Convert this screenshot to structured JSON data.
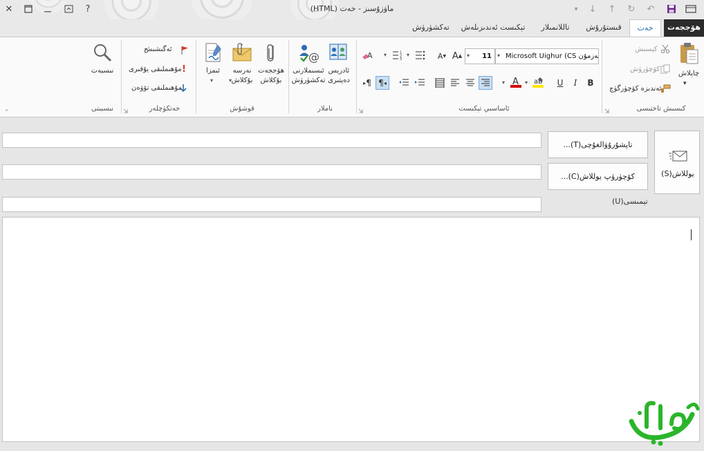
{
  "window": {
    "title": "ماۋزۇسىز - خەت (HTML)"
  },
  "titlebar_icons": {
    "close": "✕",
    "restore": "▭",
    "ribbon_options": "▣",
    "help": "?",
    "customize": "▾",
    "down": "↓",
    "up": "↑",
    "redo": "↻",
    "undo": "↶",
    "save": "save-icon",
    "app": "app-icon"
  },
  "tabs": [
    {
      "label": "ھۆججەت",
      "active": false,
      "file": true
    },
    {
      "label": "خەت",
      "active": true,
      "file": false
    },
    {
      "label": "قىستۇرۇش",
      "active": false,
      "file": false
    },
    {
      "label": "تاللانمىلار",
      "active": false,
      "file": false
    },
    {
      "label": "تېكىست ئەندىزىلەش",
      "active": false,
      "file": false
    },
    {
      "label": "تەكشۈرۈش",
      "active": false,
      "file": false
    }
  ],
  "ribbon": {
    "clipboard": {
      "group_label": "كىسىش تاختىسى",
      "paste": "چاپلاش",
      "cut": "كېسىش",
      "copy": "كۆچۈرۈش",
      "format_painter": "ئەندىزە كۆچۈرگۈچ"
    },
    "basic_text": {
      "group_label": "ئاساسىي تېكىست",
      "font_name": "Microsoft Uighur (CS مەزمۇن)",
      "font_size": "11",
      "bold": "B",
      "italic": "I",
      "underline": "U",
      "font_color_letter": "A",
      "grow_font": "A",
      "shrink_font": "A",
      "ltr_mark": "¶",
      "rtl_mark": "¶"
    },
    "names": {
      "group_label": "ناملار",
      "address_book": "ئادرېس دەپتىرى",
      "check_names": "ئىسىملارنى تەكشۈرۈش"
    },
    "include": {
      "group_label": "قوشۇش",
      "attach_file": "ھۆججەت بۇكلاش",
      "attach_item": "نەرسە بۇكلاش",
      "signature": "ئىمزا"
    },
    "tags": {
      "group_label": "خەتكۈچلەر",
      "follow_up": "ئەگىشىش",
      "high_importance": "مۇھىملىقى يۇقىرى",
      "low_importance": "مۇھىملىقى تۆۋەن"
    },
    "zoom": {
      "group_label": "نىسبىتى",
      "zoom": "نىسبەت"
    }
  },
  "message": {
    "send_label": "يوللاش(S)",
    "to_button": "تاپشۇرۇۋالغۇچى(T)...",
    "cc_button": "كۆچۈرۈپ يوللاش(C)...",
    "subject_label": "تېمىسى(U)",
    "to_value": "",
    "cc_value": "",
    "subject_value": "",
    "body_value": ""
  },
  "watermark": {
    "text": "ئالتۇن يېزى"
  },
  "colors": {
    "accent_blue": "#2b6cb0",
    "file_tab_bg": "#2b2b2b",
    "watermark_green": "#2bb52b",
    "flag_red": "#d33b2c",
    "font_color_red": "#d00000",
    "highlight_yellow": "#ffe600"
  }
}
